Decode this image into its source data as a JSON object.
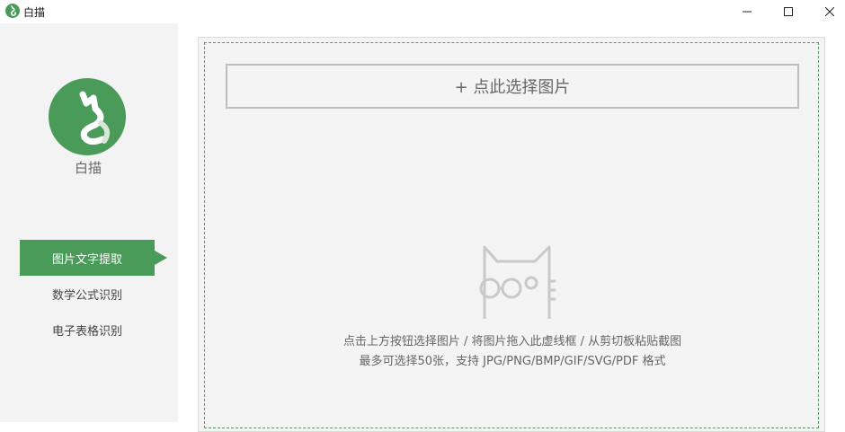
{
  "window": {
    "title": "白描",
    "minimize_icon": "minimize-icon",
    "maximize_icon": "maximize-icon",
    "close_icon": "close-icon"
  },
  "sidebar": {
    "logo_icon": "white-cat-logo",
    "app_name": "白描",
    "items": [
      {
        "label": "图片文字提取",
        "active": true
      },
      {
        "label": "数学公式识别",
        "active": false
      },
      {
        "label": "电子表格识别",
        "active": false
      }
    ]
  },
  "main": {
    "select_button": "+ 点此选择图片",
    "illustration_icon": "cat-with-glasses-icon",
    "hint_line1": "点击上方按钮选择图片 / 将图片拖入此虚线框 / 从剪切板粘贴截图",
    "hint_line2": "最多可选择50张，支持 JPG/PNG/BMP/GIF/SVG/PDF 格式"
  },
  "colors": {
    "accent": "#4a9a5a",
    "sidebar_bg": "#f3f3f3",
    "panel_bg": "#f4f4f4"
  }
}
